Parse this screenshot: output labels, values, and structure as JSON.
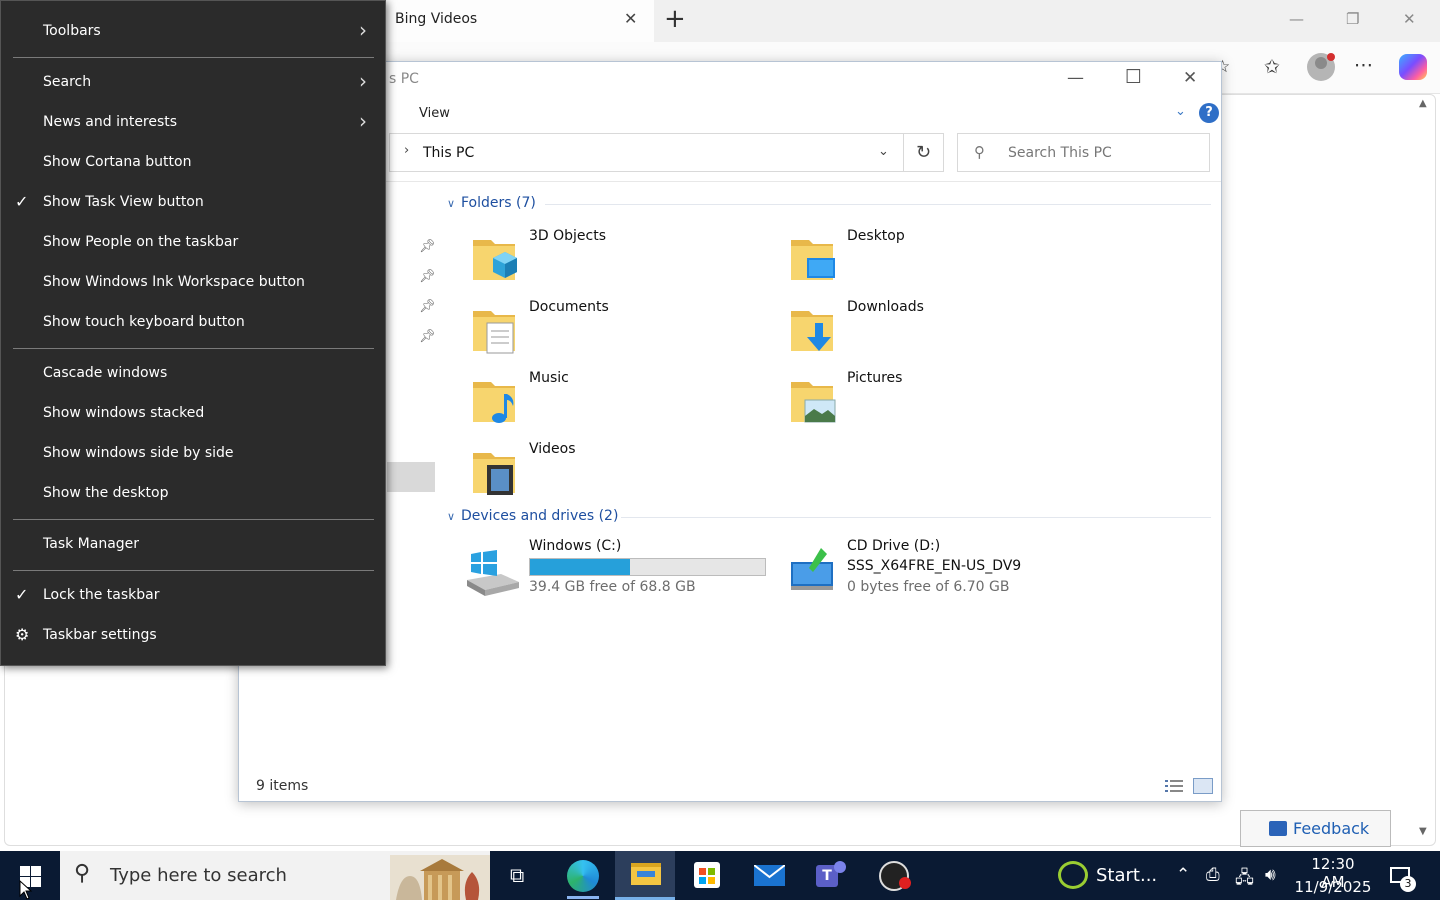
{
  "edge": {
    "tab_title": "Bing Videos",
    "tab_close": "✕",
    "new_tab": "+",
    "feedback_label": "Feedback"
  },
  "explorer": {
    "title_partial": "s PC",
    "ribbon_view": "View",
    "help": "?",
    "address": "This PC",
    "search_placeholder": "Search This PC",
    "folders_header": "Folders (7)",
    "folders": [
      {
        "name": "3D Objects"
      },
      {
        "name": "Desktop"
      },
      {
        "name": "Documents"
      },
      {
        "name": "Downloads"
      },
      {
        "name": "Music"
      },
      {
        "name": "Pictures"
      },
      {
        "name": "Videos"
      }
    ],
    "devices_header": "Devices and drives (2)",
    "drives": [
      {
        "name": "Windows (C:)",
        "free": "39.4 GB free of 68.8 GB",
        "used_fraction": 0.427
      },
      {
        "name": "CD Drive (D:)",
        "label": "SSS_X64FRE_EN-US_DV9",
        "free": "0 bytes free of 6.70 GB"
      }
    ],
    "status": "9 items"
  },
  "context_menu": {
    "items": [
      {
        "label": "Toolbars",
        "submenu": true,
        "checked": false
      },
      {
        "label": "Search",
        "submenu": true,
        "checked": false
      },
      {
        "label": "News and interests",
        "submenu": true,
        "checked": false
      },
      {
        "label": "Show Cortana button",
        "submenu": false,
        "checked": false
      },
      {
        "label": "Show Task View button",
        "submenu": false,
        "checked": true
      },
      {
        "label": "Show People on the taskbar",
        "submenu": false,
        "checked": false
      },
      {
        "label": "Show Windows Ink Workspace button",
        "submenu": false,
        "checked": false
      },
      {
        "label": "Show touch keyboard button",
        "submenu": false,
        "checked": false
      },
      {
        "label": "Cascade windows",
        "submenu": false,
        "checked": false
      },
      {
        "label": "Show windows stacked",
        "submenu": false,
        "checked": false
      },
      {
        "label": "Show windows side by side",
        "submenu": false,
        "checked": false
      },
      {
        "label": "Show the desktop",
        "submenu": false,
        "checked": false
      },
      {
        "label": "Task Manager",
        "submenu": false,
        "checked": false
      },
      {
        "label": "Lock the taskbar",
        "submenu": false,
        "checked": true
      },
      {
        "label": "Taskbar settings",
        "submenu": false,
        "checked": false,
        "icon": "gear-icon"
      }
    ]
  },
  "taskbar": {
    "search_placeholder": "Type here to search",
    "start_app_label": "Start...",
    "time": "12:30 AM",
    "date": "11/9/2025",
    "notification_count": "3"
  },
  "colors": {
    "menu_bg": "#2b2b2b",
    "taskbar_bg": "#0a1a33",
    "accent": "#1e4fa0",
    "drive_bar": "#26a0da"
  }
}
